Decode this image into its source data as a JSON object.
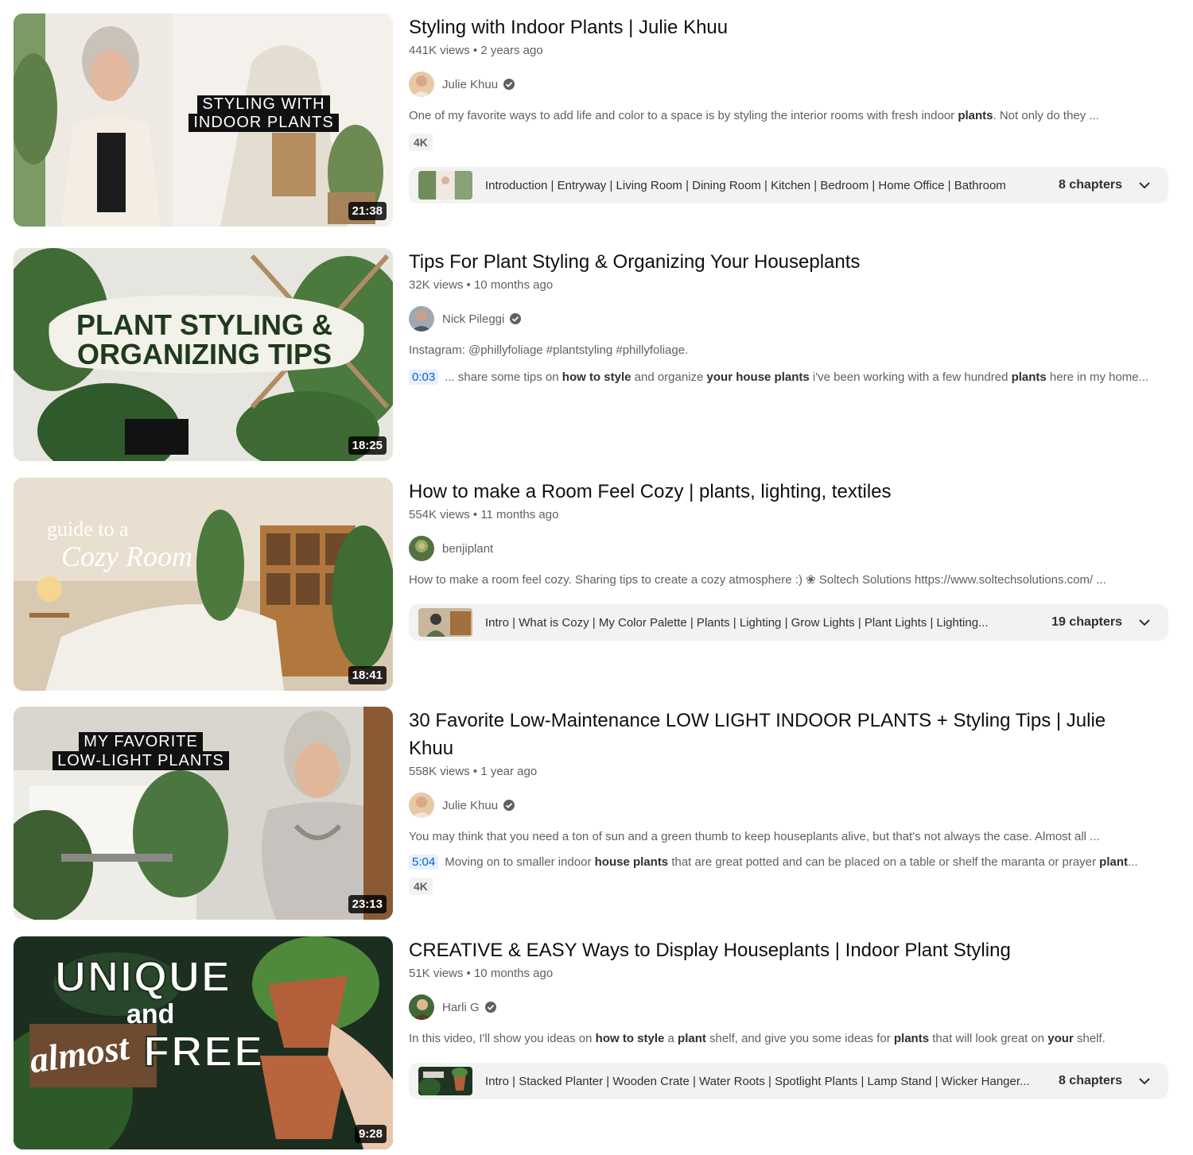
{
  "results": [
    {
      "title": "Styling with Indoor Plants | Julie Khuu",
      "views": "441K views",
      "age": "2 years ago",
      "channel": "Julie Khuu",
      "duration": "21:38",
      "thumb_text_line1": "STYLING WITH",
      "thumb_text_line2": "INDOOR PLANTS",
      "desc_pre": "One of my favorite ways to add life and color to a space is by styling the interior rooms with fresh indoor ",
      "desc_bold": "plants",
      "desc_post": ". Not only do they ...",
      "badge": "4K",
      "chapters_list": "Introduction | Entryway | Living Room | Dining Room | Kitchen | Bedroom | Home Office | Bathroom",
      "chapters_count": "8 chapters"
    },
    {
      "title": "Tips For Plant Styling & Organizing Your Houseplants",
      "views": "32K views",
      "age": "10 months ago",
      "channel": "Nick Pileggi",
      "duration": "18:25",
      "thumb_text_line1": "PLANT STYLING &",
      "thumb_text_line2": "ORGANIZING TIPS",
      "desc": "Instagram: @phillyfoliage #plantstyling #phillyfoliage.",
      "timestamp": "0:03",
      "snippet_1": "... share some tips on ",
      "snippet_b1": "how to style",
      "snippet_2": " and organize ",
      "snippet_b2": "your house plants",
      "snippet_3": " i've been working with a few hundred ",
      "snippet_b3": "plants",
      "snippet_4": " here in my home..."
    },
    {
      "title": "How to make a Room Feel Cozy | plants, lighting, textiles",
      "views": "554K views",
      "age": "11 months ago",
      "channel": "benjiplant",
      "duration": "18:41",
      "thumb_text_line1": "guide to a",
      "thumb_text_line2": "Cozy Room",
      "desc": "How to make a room feel cozy. Sharing tips to create a cozy atmosphere :) ❀ Soltech Solutions https://www.soltechsolutions.com/ ...",
      "chapters_list": "Intro | What is Cozy | My Color Palette | Plants | Lighting | Grow Lights | Plant Lights | Lighting...",
      "chapters_count": "19 chapters"
    },
    {
      "title": "30 Favorite Low-Maintenance LOW LIGHT INDOOR PLANTS + Styling Tips | Julie Khuu",
      "views": "558K views",
      "age": "1 year ago",
      "channel": "Julie Khuu",
      "duration": "23:13",
      "thumb_text_line1": "MY FAVORITE",
      "thumb_text_line2": "LOW-LIGHT PLANTS",
      "desc": "You may think that you need a ton of sun and a green thumb to keep houseplants alive, but that's not always the case. Almost all ...",
      "timestamp": "5:04",
      "snippet_1": "Moving on to smaller indoor ",
      "snippet_b1": "house plants",
      "snippet_2": " that are great potted and can be placed on a table or shelf the maranta or prayer ",
      "snippet_b2": "plant",
      "snippet_3": "...",
      "badge": "4K"
    },
    {
      "title": "CREATIVE & EASY Ways to Display Houseplants | Indoor Plant Styling",
      "views": "51K views",
      "age": "10 months ago",
      "channel": "Harli G",
      "duration": "9:28",
      "thumb_text_line1": "UNIQUE",
      "thumb_text_line2": "and",
      "thumb_text_line3": "almost",
      "thumb_text_line4": "FREE",
      "desc_1": "In this video, I'll show you ideas on ",
      "desc_b1": "how to style",
      "desc_2": " a ",
      "desc_b2": "plant",
      "desc_3": " shelf, and give you some ideas for ",
      "desc_b3": "plants",
      "desc_4": " that will look great on ",
      "desc_b4": "your",
      "desc_5": " shelf.",
      "chapters_list": "Intro | Stacked Planter | Wooden Crate | Water Roots | Spotlight Plants | Lamp Stand | Wicker Hanger...",
      "chapters_count": "8 chapters"
    }
  ],
  "colors": {
    "meta_text": "#606060",
    "title_text": "#0f0f0f",
    "timestamp_link": "#065fd4",
    "chapter_bg": "#f2f2f2"
  },
  "icons": {
    "verified": "verified-check-icon",
    "chapters_expand": "chevron-down-icon"
  }
}
